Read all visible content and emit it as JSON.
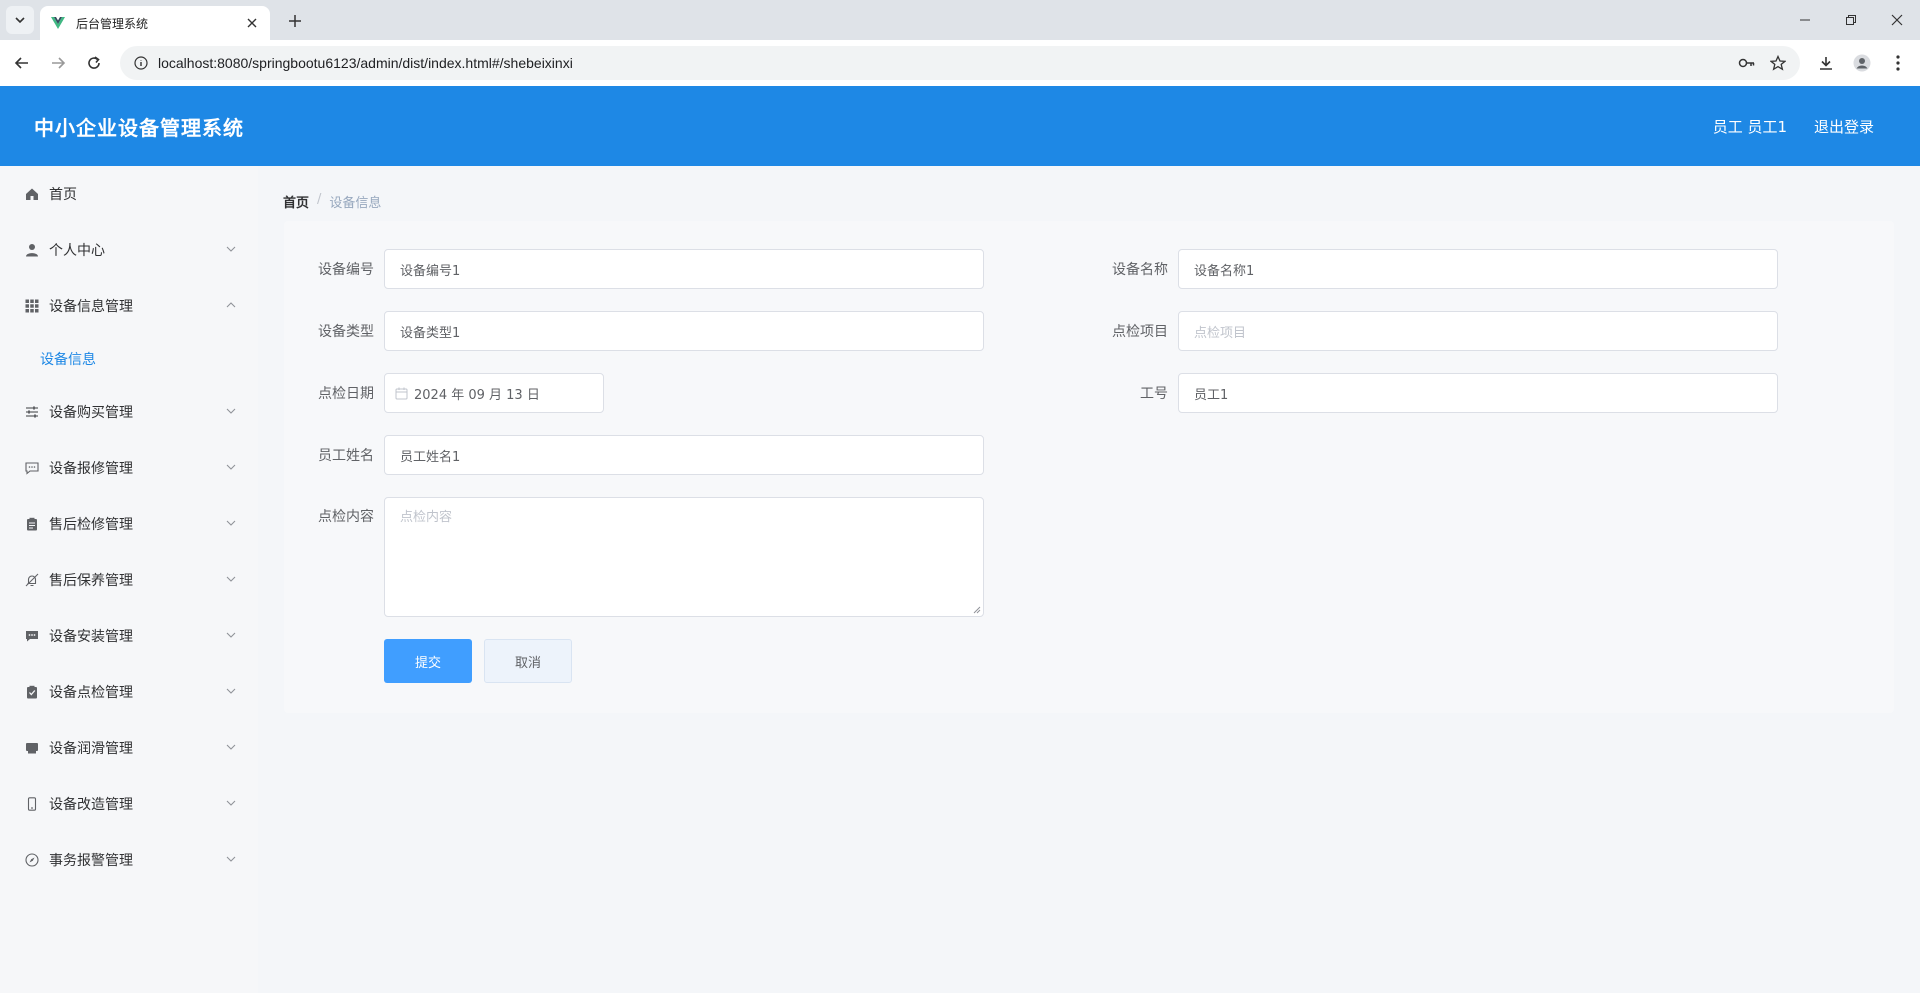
{
  "browser": {
    "tab_title": "后台管理系统",
    "url": "localhost:8080/springbootu6123/admin/dist/index.html#/shebeixinxi"
  },
  "header": {
    "app_title": "中小企业设备管理系统",
    "user_label": "员工 员工1",
    "logout_label": "退出登录"
  },
  "sidebar": {
    "items": [
      {
        "label": "首页",
        "icon": "home-icon"
      },
      {
        "label": "个人中心",
        "icon": "user-icon"
      },
      {
        "label": "设备信息管理",
        "icon": "grid-icon"
      },
      {
        "label": "设备购买管理",
        "icon": "sliders-icon"
      },
      {
        "label": "设备报修管理",
        "icon": "chat-icon"
      },
      {
        "label": "售后检修管理",
        "icon": "clipboard-icon"
      },
      {
        "label": "售后保养管理",
        "icon": "bell-off-icon"
      },
      {
        "label": "设备安装管理",
        "icon": "message-icon"
      },
      {
        "label": "设备点检管理",
        "icon": "check-clipboard-icon"
      },
      {
        "label": "设备润滑管理",
        "icon": "box-icon"
      },
      {
        "label": "设备改造管理",
        "icon": "phone-icon"
      },
      {
        "label": "事务报警管理",
        "icon": "compass-icon"
      }
    ],
    "submenu_active": "设备信息"
  },
  "breadcrumb": {
    "home": "首页",
    "separator": "/",
    "current": "设备信息"
  },
  "form": {
    "device_no_label": "设备编号",
    "device_no_value": "设备编号1",
    "device_name_label": "设备名称",
    "device_name_value": "设备名称1",
    "device_type_label": "设备类型",
    "device_type_value": "设备类型1",
    "check_item_label": "点检项目",
    "check_item_placeholder": "点检项目",
    "check_date_label": "点检日期",
    "check_date_value": "2024 年 09 月 13 日",
    "employee_no_label": "工号",
    "employee_no_value": "员工1",
    "employee_name_label": "员工姓名",
    "employee_name_value": "员工姓名1",
    "check_content_label": "点检内容",
    "check_content_placeholder": "点检内容",
    "submit_label": "提交",
    "cancel_label": "取消"
  },
  "colors": {
    "header_bg": "#1e88e5",
    "primary_button": "#409eff",
    "active_menu": "#1e88e5"
  }
}
